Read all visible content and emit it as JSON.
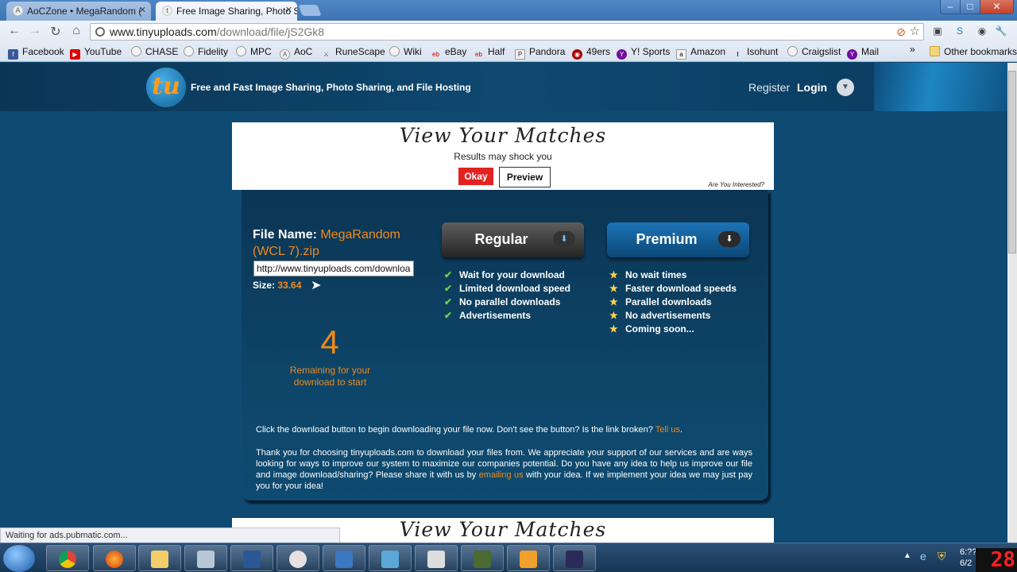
{
  "browser": {
    "tabs": [
      {
        "title": "AoCZone • MegaRandom (",
        "active": false
      },
      {
        "title": "Free Image Sharing, Photo S",
        "active": true
      }
    ],
    "url_host": "www.tinyuploads.com",
    "url_path": "/download/file/jS2Gk8",
    "bookmarks": [
      "Facebook",
      "YouTube",
      "CHASE",
      "Fidelity",
      "MPC",
      "AoC",
      "RuneScape",
      "Wiki",
      "eBay",
      "Half",
      "Pandora",
      "49ers",
      "Y! Sports",
      "Amazon",
      "Isohunt",
      "Craigslist",
      "Mail"
    ],
    "other_bookmarks": "Other bookmarks",
    "status": "Waiting for ads.pubmatic.com..."
  },
  "site": {
    "logo": "tu",
    "tagline": "Free and Fast Image Sharing, Photo Sharing, and File Hosting",
    "register": "Register",
    "login": "Login"
  },
  "ad": {
    "title": "View Your Matches",
    "subtitle": "Results may shock you",
    "okay": "Okay",
    "preview": "Preview",
    "interest": "Are You Interested?"
  },
  "file": {
    "name_label": "File Name:",
    "name": "MegaRandom (WCL 7).zip",
    "url": "http://www.tinyuploads.com/download/file/jS2Gk8",
    "size_label": "Size:",
    "size": "33.64"
  },
  "countdown": {
    "value": "4",
    "caption": "Remaining for your download to start"
  },
  "plans": {
    "regular": {
      "label": "Regular",
      "features": [
        "Wait for your download",
        "Limited download speed",
        "No parallel downloads",
        "Advertisements"
      ]
    },
    "premium": {
      "label": "Premium",
      "features": [
        "No wait times",
        "Faster download speeds",
        "Parallel downloads",
        "No advertisements",
        "Coming soon..."
      ]
    }
  },
  "help": {
    "text": "Click the download button to begin downloading your file now. Don't see the button? Is the link broken?",
    "link": "Tell us",
    "end": "."
  },
  "thanks": {
    "part1": "Thank you for choosing tinyuploads.com to download your files from. We appreciate your support of our services and are ways looking for ways to improve our system to maximize our companies potential. Do you have any idea to help us improve our file and image download/sharing? Please share it with us by",
    "link": "emailing us",
    "part2": "with your idea. If we implement your idea we may just pay you for your idea!"
  },
  "taskbar": {
    "clock_time": "6:??",
    "clock_date": "6/2",
    "counter": "28"
  },
  "colors": {
    "accent_orange": "#f08a1c",
    "panel_blue": "#0d4568",
    "ad_red": "#e42222"
  }
}
